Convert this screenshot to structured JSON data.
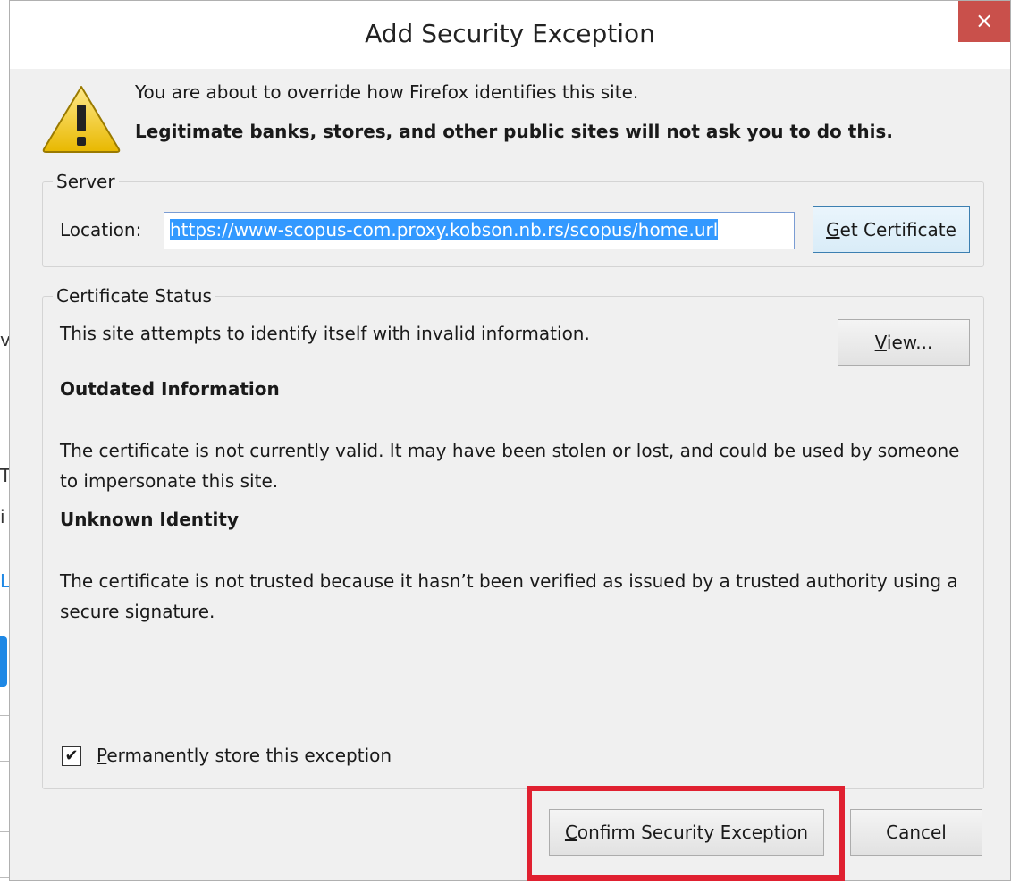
{
  "dialog": {
    "title": "Add Security Exception",
    "close_glyph": "×",
    "intro_line1": "You are about to override how Firefox identifies this site.",
    "intro_line2": "Legitimate banks, stores, and other public sites will not ask you to do this."
  },
  "server": {
    "group_label": "Server",
    "location_label": "Location:",
    "location_value": "https://www-scopus-com.proxy.kobson.nb.rs/scopus/home.url",
    "get_certificate_first": "G",
    "get_certificate_rest": "et Certificate"
  },
  "certificate_status": {
    "group_label": "Certificate Status",
    "summary": "This site attempts to identify itself with invalid information.",
    "view_button_first": "V",
    "view_button_rest": "iew...",
    "outdated_heading": "Outdated Information",
    "outdated_text": "The certificate is not currently valid. It may have been stolen or lost, and could be used by someone to impersonate this site.",
    "unknown_heading": "Unknown Identity",
    "unknown_text": "The certificate is not trusted because it hasn’t been verified as issued by a trusted authority using a secure signature.",
    "permanent_checkbox_first": "P",
    "permanent_checkbox_rest": "ermanently store this exception",
    "permanent_checked": true
  },
  "buttons": {
    "confirm_first": "C",
    "confirm_rest": "onfirm Security Exception",
    "cancel": "Cancel"
  },
  "background": {
    "fragment_1": "v",
    "fragment_2": "T",
    "fragment_3": "i",
    "fragment_4": "L"
  },
  "colors": {
    "close_button": "#c9504b",
    "highlight": "#e02030",
    "selection": "#3399ff"
  },
  "icons": {
    "warning": "warning-triangle-icon",
    "close": "close-icon",
    "checkmark": "checkmark-icon"
  }
}
